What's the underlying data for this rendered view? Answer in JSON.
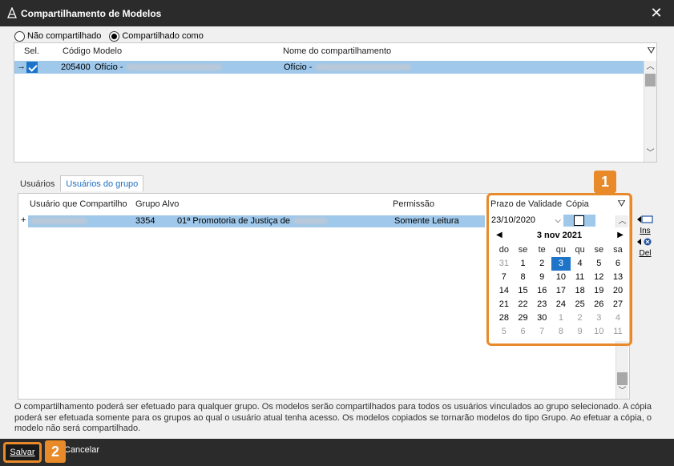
{
  "window": {
    "title": "Compartilhamento de Modelos",
    "close_label": "✕"
  },
  "share_mode": {
    "option_not_shared": "Não compartilhado",
    "option_shared_as": "Compartilhado como",
    "selected": "Compartilhado como"
  },
  "models_grid": {
    "headers": {
      "sel": "Sel.",
      "code": "Código",
      "model": "Modelo",
      "share_name": "Nome do compartilhamento"
    },
    "row": {
      "code": "205400",
      "model_prefix": "Ofício -",
      "share_name_prefix": "Ofício -",
      "selected": true
    }
  },
  "tabs": [
    {
      "label": "Usuários"
    },
    {
      "label": "Usuários do grupo"
    }
  ],
  "group_grid": {
    "headers": {
      "user": "Usuário que Compartilho",
      "group": "Grupo Alvo",
      "permission": "Permissão",
      "deadline": "Prazo de Validade",
      "copy": "Cópia"
    },
    "row": {
      "group_code": "3354",
      "group_name_prefix": "01ª Promotoria de Justiça de",
      "permission": "Somente Leitura",
      "deadline": "23/10/2020"
    }
  },
  "side_buttons": {
    "insert": "Ins",
    "delete": "Del"
  },
  "calendar": {
    "month_label": "3 nov 2021",
    "weekdays": [
      "do",
      "se",
      "te",
      "qu",
      "qu",
      "se",
      "sa"
    ],
    "weeks": [
      [
        "31",
        "1",
        "2",
        "3",
        "4",
        "5",
        "6"
      ],
      [
        "7",
        "8",
        "9",
        "10",
        "11",
        "12",
        "13"
      ],
      [
        "14",
        "15",
        "16",
        "17",
        "18",
        "19",
        "20"
      ],
      [
        "21",
        "22",
        "23",
        "24",
        "25",
        "26",
        "27"
      ],
      [
        "28",
        "29",
        "30",
        "1",
        "2",
        "3",
        "4"
      ],
      [
        "5",
        "6",
        "7",
        "8",
        "9",
        "10",
        "11"
      ]
    ],
    "selected_day": "3"
  },
  "info_text": "O compartilhamento poderá ser efetuado para qualquer grupo. Os modelos serão compartilhados para todos os usuários vinculados ao grupo selecionado. A cópia poderá ser efetuada somente para os grupos ao qual o usuário atual tenha acesso. Os modelos copiados se tornarão modelos do tipo Grupo. Ao efetuar a cópia, o modelo não será compartilhado.",
  "footer": {
    "save_label": "Salvar",
    "cancel_label": "Cancelar"
  },
  "callouts": {
    "one": "1",
    "two": "2"
  },
  "colors": {
    "accent": "#e88a2a",
    "selection": "#9fc8ea",
    "primary": "#1e74c8",
    "titlebar": "#2b2b2b"
  }
}
